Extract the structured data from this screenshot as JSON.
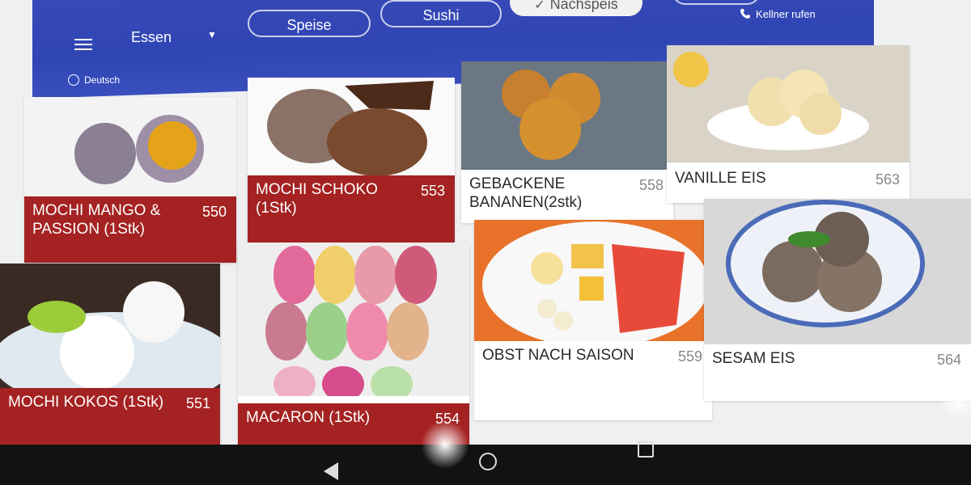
{
  "header": {
    "category": "Essen",
    "tabs": [
      {
        "label": "Speise",
        "active": false
      },
      {
        "label": "Sushi",
        "active": false
      },
      {
        "label": "Nachspeis",
        "active": true
      }
    ],
    "call_waiter": "Kellner rufen",
    "language": "Deutsch",
    "accent_color": "#3548b6"
  },
  "menu": {
    "items": [
      {
        "name": "MOCHI MANGO & PASSION (1Stk)",
        "number": "550"
      },
      {
        "name": "MOCHI SCHOKO (1Stk)",
        "number": "553"
      },
      {
        "name": "GEBACKENE BANANEN(2stk)",
        "number": "558"
      },
      {
        "name": "VANILLE EIS",
        "number": "563"
      },
      {
        "name": "MOCHI KOKOS (1Stk)",
        "number": "551"
      },
      {
        "name": "MACARON (1Stk)",
        "number": "554"
      },
      {
        "name": "OBST NACH SAISON",
        "number": "559"
      },
      {
        "name": "SESAM EIS",
        "number": "564"
      }
    ],
    "highlight_color": "#a52222"
  }
}
